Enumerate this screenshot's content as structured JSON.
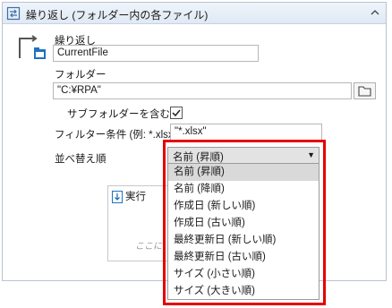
{
  "title": "繰り返し (フォルダー内の各ファイル)",
  "loop": {
    "label": "繰り返し",
    "variable": "CurrentFile"
  },
  "folder": {
    "label": "フォルダー",
    "value": "\"C:¥RPA\""
  },
  "subfolders": {
    "label": "サブフォルダーを含む",
    "checked": true
  },
  "filter": {
    "label": "フィルター条件 (例: *.xlsx)",
    "value": "\"*.xlsx\""
  },
  "sort": {
    "label": "並べ替え順",
    "selected": "名前 (昇順)",
    "options": [
      "名前 (昇順)",
      "名前 (降順)",
      "作成日 (新しい順)",
      "作成日 (古い順)",
      "最終更新日 (新しい順)",
      "最終更新日 (古い順)",
      "サイズ (小さい順)",
      "サイズ (大きい順)"
    ]
  },
  "execute": {
    "label": "実行",
    "hint": "ここに"
  },
  "colors": {
    "highlight": "#e60000",
    "accent": "#1e73be"
  },
  "icons": {
    "title": "loop-arrow-icon",
    "collapse": "chevron-up-icon",
    "loop": "loop-folder-icon",
    "folder_button": "folder-icon",
    "execute": "execute-icon",
    "dropdown": "caret-down-icon"
  }
}
